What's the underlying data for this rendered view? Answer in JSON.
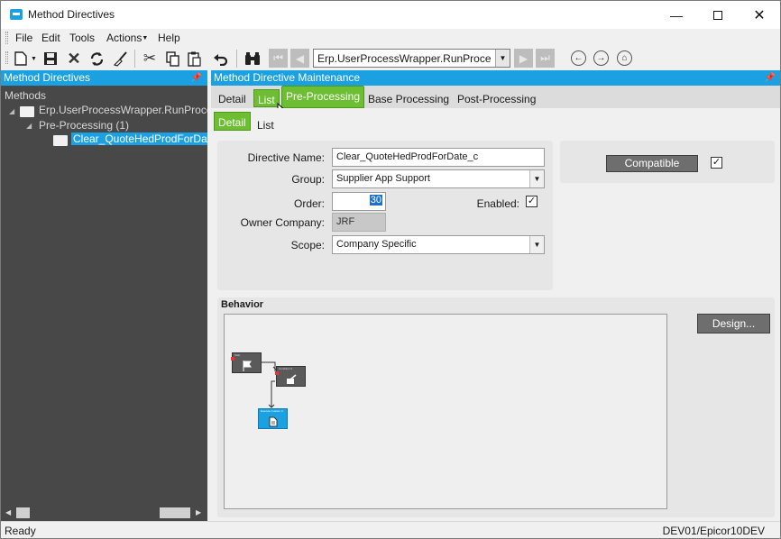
{
  "window": {
    "title": "Method Directives"
  },
  "menu": {
    "items": [
      "File",
      "Edit",
      "Tools",
      "Actions",
      "Help"
    ]
  },
  "toolbar": {
    "method_combo_value": "Erp.UserProcessWrapper.RunProce"
  },
  "left_panel": {
    "header": "Method Directives",
    "tree": {
      "root": "Methods",
      "method": "Erp.UserProcessWrapper.RunProce",
      "group": "Pre-Processing (1)",
      "directive": "Clear_QuoteHedProdForDat"
    }
  },
  "right_panel": {
    "header": "Method Directive Maintenance",
    "tabs": [
      "Detail",
      "List",
      "Pre-Processing",
      "Base Processing",
      "Post-Processing"
    ],
    "active_tab": "Pre-Processing",
    "subtabs": [
      "Detail",
      "List"
    ],
    "active_subtab": "Detail",
    "form": {
      "directive_name_label": "Directive Name:",
      "directive_name_value": "Clear_QuoteHedProdForDate_c",
      "group_label": "Group:",
      "group_value": "Supplier App Support",
      "order_label": "Order:",
      "order_value": "30",
      "enabled_label": "Enabled:",
      "enabled": true,
      "owner_label": "Owner Company:",
      "owner_value": "JRF",
      "scope_label": "Scope:",
      "scope_value": "Company Specific"
    },
    "compatible": {
      "label": "Compatible",
      "checked": true
    },
    "behavior": {
      "label": "Behavior",
      "design_button": "Design...",
      "nodes": [
        "Start",
        "Condition 0",
        "Execute Custom C"
      ]
    }
  },
  "status": {
    "left": "Ready",
    "right": "DEV01/Epicor10DEV"
  },
  "colors": {
    "accent": "#1ba1e2",
    "tab_green": "#6dbe32",
    "panel_dark": "#484848"
  }
}
